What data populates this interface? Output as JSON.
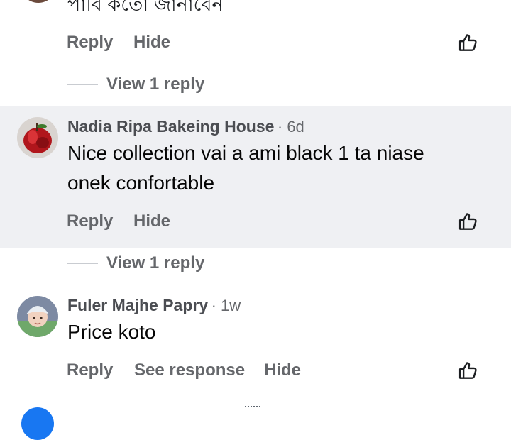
{
  "comments": [
    {
      "text_cutoff": "পাবি কতো জানাবেন",
      "actions": {
        "reply": "Reply",
        "hide": "Hide"
      },
      "view_replies": "View 1 reply"
    },
    {
      "author": "Nadia Ripa Bakeing House",
      "time": "· 6d",
      "text_line1": "Nice collection  vai a ami  black 1 ta niase",
      "text_line2": "onek confortable",
      "actions": {
        "reply": "Reply",
        "hide": "Hide"
      },
      "view_replies": "View 1 reply"
    },
    {
      "author": "Fuler Majhe Papry",
      "time": "· 1w",
      "text": "Price koto",
      "actions": {
        "reply": "Reply",
        "see_response": "See response",
        "hide": "Hide"
      }
    }
  ],
  "icons": {
    "like": "thumbs-up-outline-icon",
    "avatar1": "apple-photo-avatar",
    "avatar2": "baby-photo-avatar"
  },
  "colors": {
    "highlight_bg": "#eff0f3",
    "secondary_text": "#65676b",
    "name_text": "#4b4d52"
  }
}
